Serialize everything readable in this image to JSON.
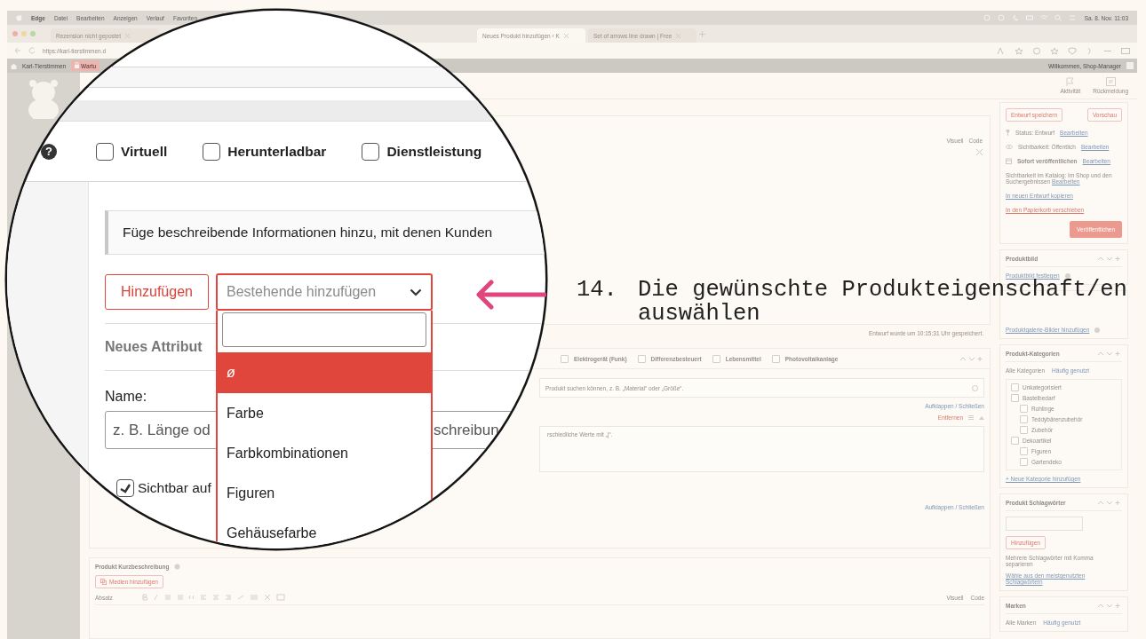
{
  "browser": {
    "menu_bar": {
      "app": "Edge",
      "items": [
        "Datei",
        "Bearbeiten",
        "Anzeigen",
        "Verlauf",
        "Favoriten"
      ],
      "clock": "Sa. 8. Nov. 11:03"
    },
    "tabs": [
      {
        "label": "Rezension nicht gepostet",
        "selected": false
      },
      {
        "label": "Neues Produkt hinzufügen ‹ K",
        "selected": true
      },
      {
        "label": "Set of arrows line drawn | Free",
        "selected": false
      }
    ],
    "address": "https://karl-tierstimmen.d"
  },
  "admin_bar": {
    "site": "Karl-Tierstimmen",
    "maintenance": "Wartu",
    "greeting": "Willkommen, Shop-Manager"
  },
  "header_actions": [
    "Aktivität",
    "Rückmeldung"
  ],
  "editor": {
    "mode_tabs": [
      "Visuell",
      "Code"
    ]
  },
  "save_status": "Entwurf wurde um 10:15:31 Uhr gespeichert.",
  "product_data": {
    "types": [
      {
        "label": "Elektrogerät (Funk)",
        "checked": false
      },
      {
        "label": "Differenzbesteuert",
        "checked": false
      },
      {
        "label": "Lebensmittel",
        "checked": false
      },
      {
        "label": "Photovoltaikanlage",
        "checked": false
      }
    ],
    "attribute_search_placeholder": "Produkt suchen können, z. B. „Material“ oder „Größe“.",
    "toggle_link": "Aufklappen / Schließen",
    "remove_link": "Entfernen",
    "values_placeholder": "rschiedliche Werte mit „|“.",
    "toggle_link_bottom": "Aufklappen / Schließen"
  },
  "short_description": {
    "title": "Produkt Kurzbeschreibung",
    "media_button": "Medien hinzufügen",
    "format": "Absatz",
    "mode_tabs": [
      "Visuell",
      "Code"
    ]
  },
  "publish": {
    "save_draft": "Entwurf speichern",
    "preview": "Vorschau",
    "status": {
      "text": "Status: Entwurf",
      "link": "Bearbeiten"
    },
    "visibility": {
      "text": "Sichtbarkeit: Öffentlich",
      "link": "Bearbeiten"
    },
    "schedule": {
      "text": "Sofort veröffentlichen",
      "link": "Bearbeiten"
    },
    "catalog": {
      "text": "Sichtbarkeit im Katalog: Im Shop und den Suchergebnissen",
      "link": "Bearbeiten"
    },
    "copy_link": "In neuen Entwurf kopieren",
    "trash_link": "In den Papierkorb verschieben",
    "publish_button": "Veröffentlichen"
  },
  "product_image": {
    "title": "Produktbild",
    "link": "Produktbild festlegen"
  },
  "gallery": {
    "link": "Produktgalerie-Bilder hinzufügen"
  },
  "categories": {
    "title": "Produkt-Kategorien",
    "tabs": [
      {
        "label": "Alle Kategorien",
        "selected": true
      },
      {
        "label": "Häufig genutzt",
        "selected": false
      }
    ],
    "items": [
      {
        "label": "Unkategorisiert",
        "checked": false
      },
      {
        "label": "Bastelbedarf",
        "checked": false,
        "children": [
          {
            "label": "Rohlinge",
            "checked": false
          },
          {
            "label": "Teddybärenzubehör",
            "checked": false
          },
          {
            "label": "Zubehör",
            "checked": false
          }
        ]
      },
      {
        "label": "Dekoartikel",
        "checked": false,
        "children": [
          {
            "label": "Figuren",
            "checked": false
          },
          {
            "label": "Gartendeko",
            "checked": false
          }
        ]
      }
    ],
    "add_link": "+ Neue Kategorie hinzufügen"
  },
  "tags": {
    "title": "Produkt Schlagwörter",
    "add_button": "Hinzufügen",
    "hint": "Mehrere Schlagwörter mit Komma separieren",
    "choose_link": "Wähle aus den meistgenutzten Schlagwörtern"
  },
  "brands": {
    "title": "Marken",
    "tabs": [
      {
        "label": "Alle Marken",
        "selected": true
      },
      {
        "label": "Häufig genutzt",
        "selected": false
      }
    ]
  },
  "lens": {
    "help_icon": "?",
    "product_types": [
      {
        "label": "Virtuell",
        "checked": false
      },
      {
        "label": "Herunterladbar",
        "checked": false
      },
      {
        "label": "Dienstleistung",
        "checked": false
      }
    ],
    "notice": "Füge beschreibende Informationen hinzu, mit denen Kunden",
    "add_button": "Hinzufügen",
    "existing_select": "Bestehende hinzufügen",
    "options": [
      {
        "label": "ø",
        "selected": true
      },
      {
        "label": "Farbe",
        "selected": false
      },
      {
        "label": "Farbkombinationen",
        "selected": false
      },
      {
        "label": "Figuren",
        "selected": false
      },
      {
        "label": "Gehäusefarbe",
        "selected": false
      }
    ],
    "new_attribute": "Neues Attribut",
    "name_label": "Name:",
    "name_placeholder": "z. B. Länge od",
    "value_placeholder": "schreibun",
    "visible": {
      "label": "Sichtbar auf",
      "checked": true
    }
  },
  "callout": {
    "number": "14.",
    "text": "Die gewünschte Produkteigenschaft/en auswählen"
  }
}
